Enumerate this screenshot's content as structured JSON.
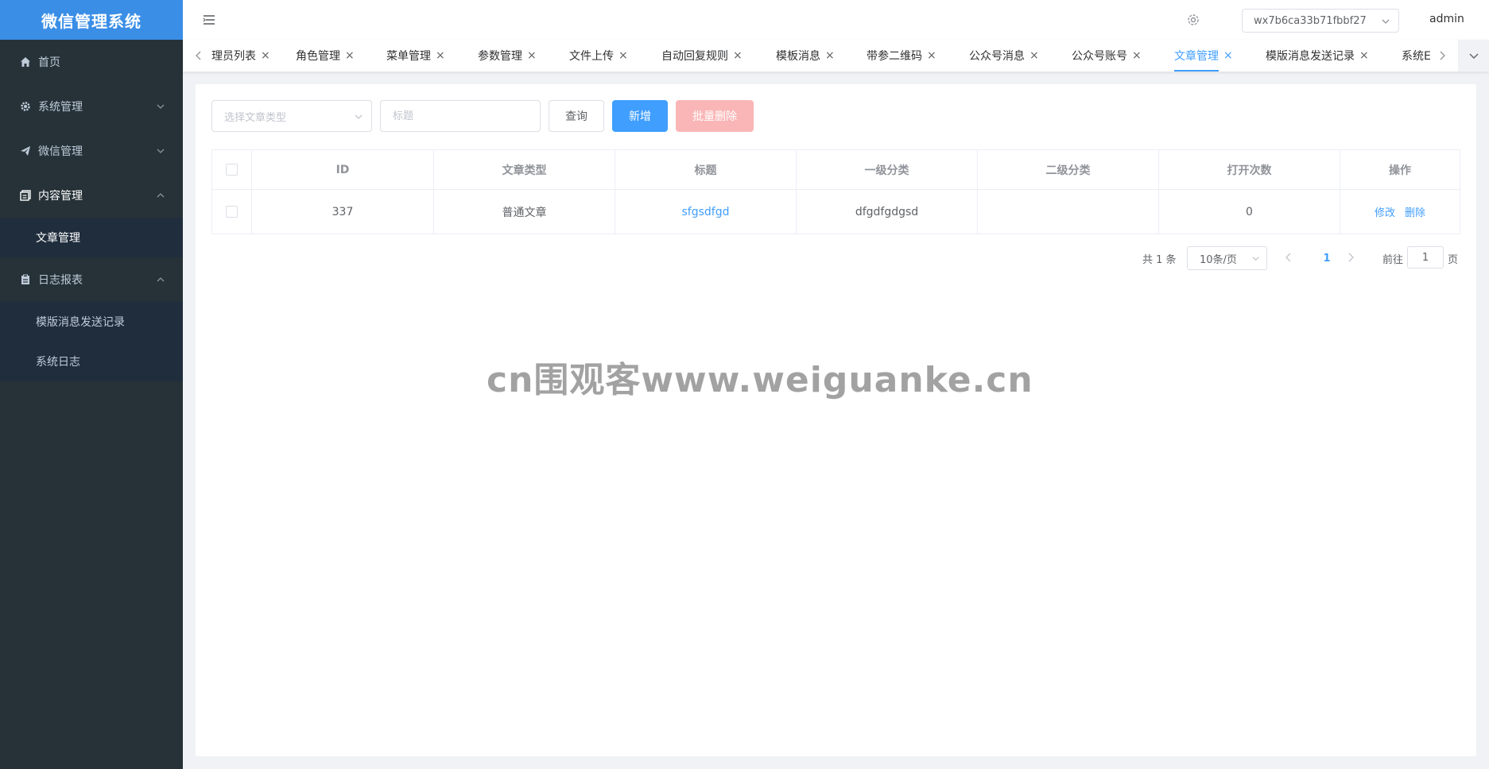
{
  "app": {
    "title": "微信管理系统"
  },
  "sidebar": {
    "items": [
      {
        "label": "首页",
        "icon": "home-icon"
      },
      {
        "label": "系统管理",
        "icon": "gear-icon",
        "expanded": false
      },
      {
        "label": "微信管理",
        "icon": "send-icon",
        "expanded": false
      },
      {
        "label": "内容管理",
        "icon": "document-icon",
        "expanded": true,
        "children": [
          {
            "label": "文章管理",
            "active": true
          }
        ]
      },
      {
        "label": "日志报表",
        "icon": "clipboard-icon",
        "expanded": true,
        "children": [
          {
            "label": "模版消息发送记录"
          },
          {
            "label": "系统日志"
          }
        ]
      }
    ]
  },
  "header": {
    "appid": "wx7b6ca33b71fbbf27",
    "user": "admin"
  },
  "tabs": [
    {
      "label": "理员列表"
    },
    {
      "label": "角色管理"
    },
    {
      "label": "菜单管理"
    },
    {
      "label": "参数管理"
    },
    {
      "label": "文件上传"
    },
    {
      "label": "自动回复规则"
    },
    {
      "label": "模板消息"
    },
    {
      "label": "带参二维码"
    },
    {
      "label": "公众号消息"
    },
    {
      "label": "公众号账号"
    },
    {
      "label": "文章管理",
      "active": true
    },
    {
      "label": "模版消息发送记录"
    },
    {
      "label": "系统E"
    }
  ],
  "tab_close": "×",
  "filters": {
    "type_placeholder": "选择文章类型",
    "title_placeholder": "标题",
    "query_label": "查询",
    "add_label": "新增",
    "batch_delete_label": "批量删除"
  },
  "table": {
    "columns": [
      "ID",
      "文章类型",
      "标题",
      "一级分类",
      "二级分类",
      "打开次数",
      "操作"
    ],
    "rows": [
      {
        "id": "337",
        "type": "普通文章",
        "title": "sfgsdfgd",
        "category1": "dfgdfgdgsd",
        "category2": "",
        "open_count": "0"
      }
    ],
    "action_edit": "修改",
    "action_delete": "删除"
  },
  "pagination": {
    "total": "共 1 条",
    "page_size": "10条/页",
    "current_page": "1",
    "goto_label": "前往",
    "goto_value": "1",
    "goto_suffix": "页"
  },
  "watermark": "cn围观客www.weiguanke.cn",
  "colors": {
    "primary": "#409eff",
    "sidebar": "#263238",
    "danger_light": "#fab6b6"
  }
}
